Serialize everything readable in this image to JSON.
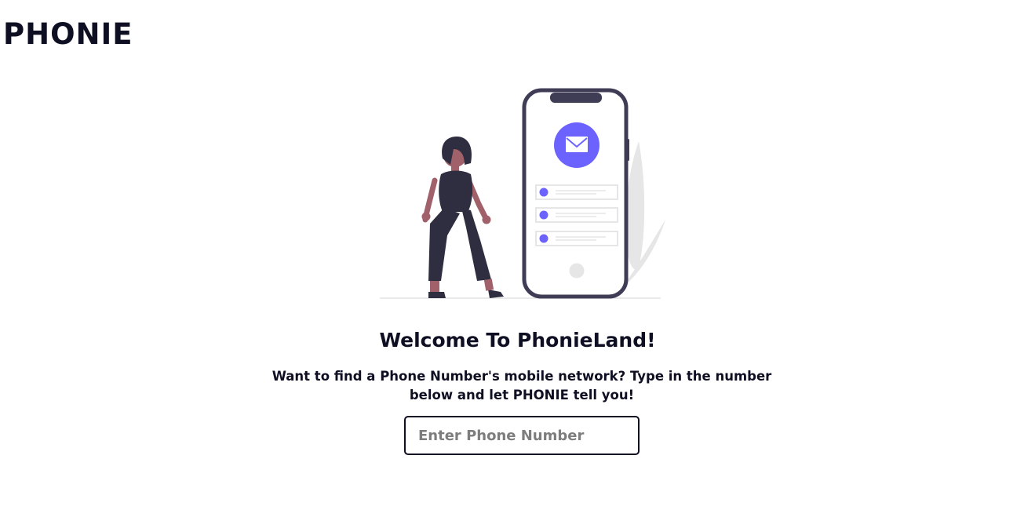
{
  "header": {
    "logo_text": "PHONIE"
  },
  "hero": {
    "illustration_name": "woman-with-smartphone-messages",
    "colors": {
      "accent": "#6c63ff",
      "dark": "#3f3d56",
      "figure": "#2f2e41",
      "skin": "#a0616a",
      "light_gray": "#e6e6e6"
    }
  },
  "main": {
    "title": "Welcome To PhonieLand!",
    "description": "Want to find a Phone Number's mobile network? Type in the number below and let PHONIE tell you!",
    "phone_input": {
      "placeholder": "Enter Phone Number",
      "value": ""
    }
  }
}
